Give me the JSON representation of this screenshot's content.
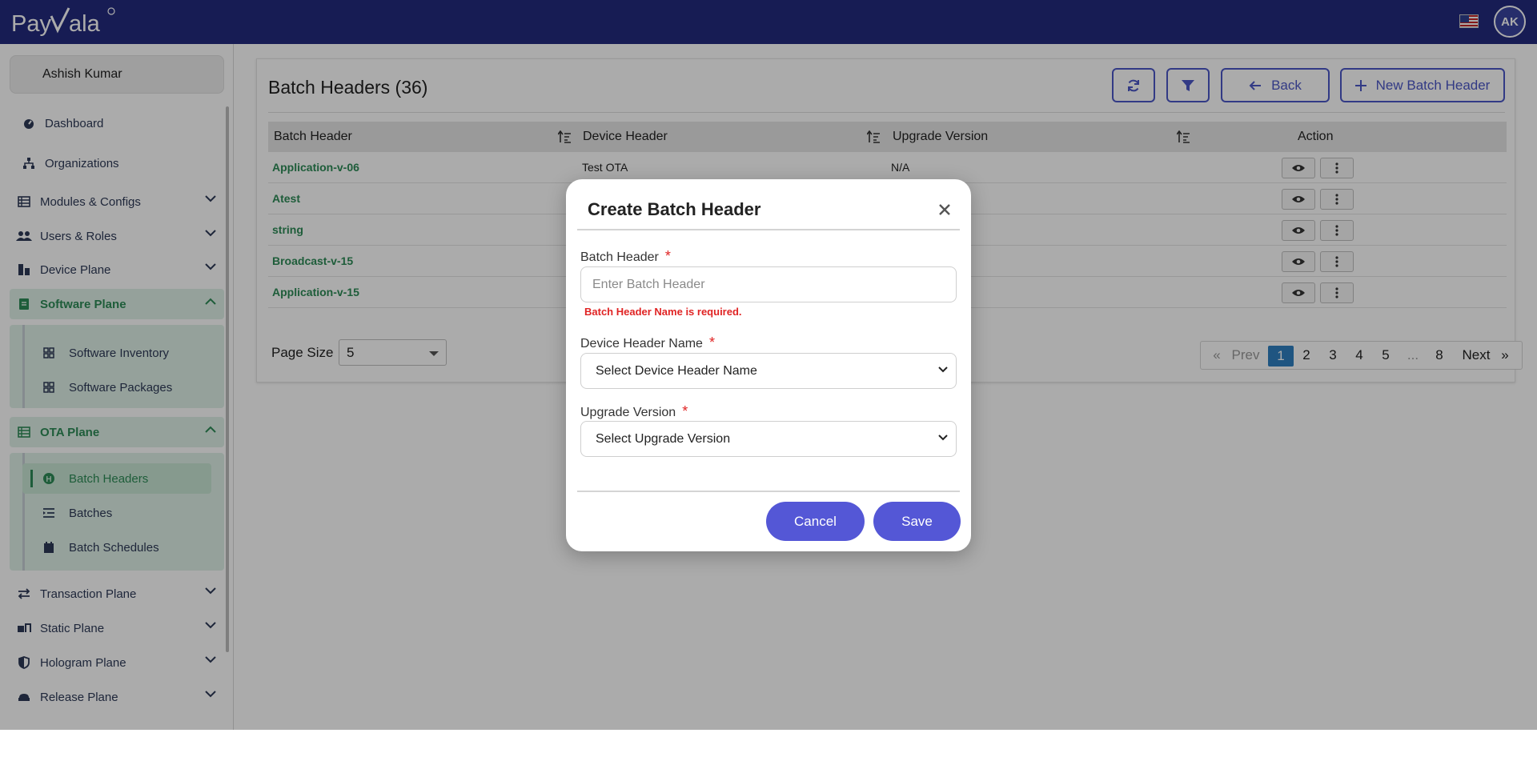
{
  "header": {
    "logo_text": "PayVala",
    "flag_icon": "us-flag-icon",
    "avatar_initials": "AK",
    "bar_color": "#232b7e"
  },
  "sidebar": {
    "user_name": "Ashish Kumar",
    "items": [
      {
        "label": "Dashboard",
        "icon": "dashboard-icon"
      },
      {
        "label": "Organizations",
        "icon": "organizations-icon"
      },
      {
        "label": "Modules & Configs",
        "icon": "modules-icon"
      },
      {
        "label": "Users & Roles",
        "icon": "users-icon"
      },
      {
        "label": "Device Plane",
        "icon": "device-icon"
      },
      {
        "label": "Software Plane",
        "icon": "software-icon"
      },
      {
        "label": "OTA Plane",
        "icon": "ota-icon"
      },
      {
        "label": "Transaction Plane",
        "icon": "transaction-icon"
      },
      {
        "label": "Static Plane",
        "icon": "static-icon"
      },
      {
        "label": "Hologram Plane",
        "icon": "hologram-icon"
      },
      {
        "label": "Release Plane",
        "icon": "release-icon"
      }
    ],
    "software_subitems": [
      {
        "label": "Software Inventory"
      },
      {
        "label": "Software Packages"
      }
    ],
    "ota_subitems": [
      {
        "label": "Batch Headers"
      },
      {
        "label": "Batches"
      },
      {
        "label": "Batch Schedules"
      }
    ],
    "accent_color": "#2e8b57"
  },
  "page": {
    "title": "Batch Headers (36)",
    "back_label": "Back",
    "new_label": "New Batch Header",
    "columns": [
      "Batch Header",
      "Device Header",
      "Upgrade Version",
      "Action"
    ],
    "rows": [
      {
        "batch_header": "Application-v-06",
        "device_header": "Test OTA",
        "upgrade_version": "N/A"
      },
      {
        "batch_header": "Atest",
        "device_header": "",
        "upgrade_version": ""
      },
      {
        "batch_header": "string",
        "device_header": "",
        "upgrade_version": ""
      },
      {
        "batch_header": "Broadcast-v-15",
        "device_header": "",
        "upgrade_version": ""
      },
      {
        "batch_header": "Application-v-15",
        "device_header": "",
        "upgrade_version": ""
      }
    ],
    "page_size_label": "Page Size",
    "page_size_value": "5",
    "pagination": {
      "first": "«",
      "prev": "Prev",
      "pages": [
        "1",
        "2",
        "3",
        "4",
        "5",
        "...",
        "8"
      ],
      "current": "1",
      "next": "Next",
      "last": "»"
    },
    "primary_color": "#4b57c6"
  },
  "modal": {
    "title": "Create Batch Header",
    "fields": {
      "batch_header": {
        "label": "Batch Header",
        "placeholder": "Enter Batch Header",
        "value": "",
        "error": "Batch Header Name is required."
      },
      "device_header": {
        "label": "Device Header Name",
        "selected": "Select Device Header Name"
      },
      "upgrade_version": {
        "label": "Upgrade Version",
        "selected": "Select Upgrade Version"
      }
    },
    "required_marker": "*",
    "cancel_label": "Cancel",
    "save_label": "Save",
    "button_color": "#5457d6"
  }
}
